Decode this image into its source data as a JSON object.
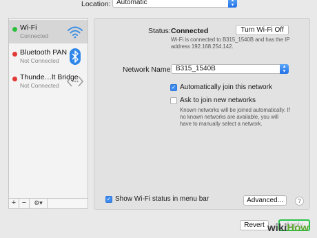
{
  "location": {
    "label": "Location:",
    "value": "Automatic"
  },
  "services": [
    {
      "name": "Wi-Fi",
      "status": "Connected",
      "dot_color": "#2cbf3c",
      "icon": "wifi-icon"
    },
    {
      "name": "Bluetooth PAN",
      "status": "Not Connected",
      "dot_color": "#e23a36",
      "icon": "bluetooth-icon"
    },
    {
      "name": "Thunde…lt Bridge",
      "status": "Not Connected",
      "dot_color": "#e23a36",
      "icon": "thunderbolt-bridge-icon"
    }
  ],
  "sidebar_toolbar": {
    "add": "+",
    "remove": "−",
    "gear": "⚙▾"
  },
  "status": {
    "label": "Status:",
    "value": "Connected",
    "turn_off_button": "Turn Wi-Fi Off",
    "description": "Wi-Fi is connected to B315_1540B and has the IP address 192.168.254.142."
  },
  "network": {
    "label": "Network Name:",
    "value": "B315_1540B"
  },
  "auto_join": {
    "label": "Automatically join this network",
    "checked": true
  },
  "ask_join": {
    "label": "Ask to join new networks",
    "checked": false,
    "description": "Known networks will be joined automatically. If no known networks are available, you will have to manually select a network."
  },
  "show_status": {
    "label": "Show Wi-Fi status in menu bar",
    "checked": true
  },
  "advanced_button": "Advanced...",
  "help_button": "?",
  "revert_button": "Revert",
  "apply_button": "Apply",
  "watermark": {
    "wiki": "wiki",
    "how": "How"
  },
  "colors": {
    "accent": "#3d8bf2",
    "highlight": "#27c14a",
    "connected": "#2cbf3c",
    "disconnected": "#e23a36"
  }
}
